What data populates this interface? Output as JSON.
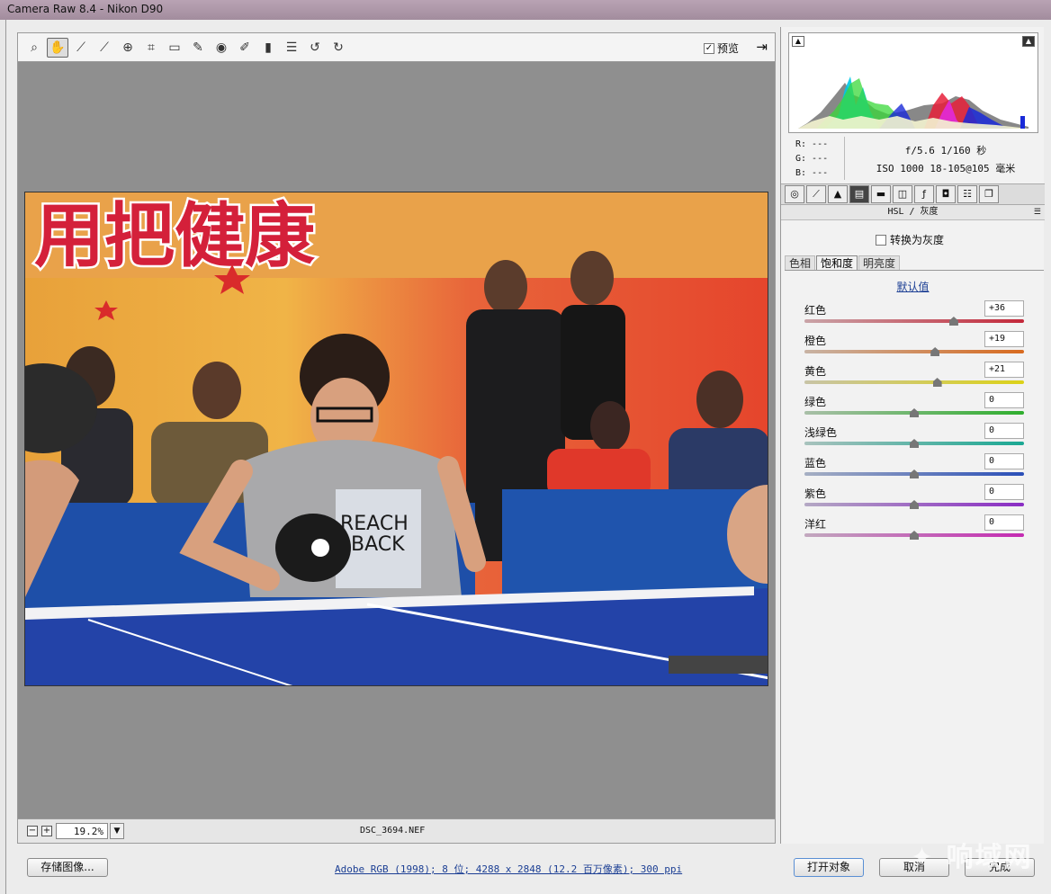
{
  "window": {
    "title": "Camera Raw 8.4 -  Nikon D90"
  },
  "toolbar": {
    "tools": [
      {
        "name": "zoom-tool-icon",
        "glyph": "⌕"
      },
      {
        "name": "hand-tool-icon",
        "glyph": "✋",
        "active": true
      },
      {
        "name": "white-balance-tool-icon",
        "glyph": "⁄"
      },
      {
        "name": "color-sampler-tool-icon",
        "glyph": "⁄"
      },
      {
        "name": "targeted-adjustment-tool-icon",
        "glyph": "⊕"
      },
      {
        "name": "crop-tool-icon",
        "glyph": "⌗"
      },
      {
        "name": "straighten-tool-icon",
        "glyph": "▭"
      },
      {
        "name": "spot-removal-tool-icon",
        "glyph": "⁄"
      },
      {
        "name": "red-eye-tool-icon",
        "glyph": "◉"
      },
      {
        "name": "adjustment-brush-icon",
        "glyph": "⁄"
      },
      {
        "name": "graduated-filter-icon",
        "glyph": "▮"
      },
      {
        "name": "preferences-icon",
        "glyph": "☰"
      },
      {
        "name": "rotate-left-icon",
        "glyph": "↺"
      },
      {
        "name": "rotate-right-icon",
        "glyph": "↻"
      }
    ],
    "preview_label": "预览",
    "preview_checked": "✓"
  },
  "status": {
    "zoom": "19.2%",
    "filename": "DSC_3694.NEF"
  },
  "info": {
    "r": "R:  ---",
    "g": "G:  ---",
    "b": "B:  ---",
    "exposure": "f/5.6   1/160 秒",
    "iso_lens": "ISO 1000   18-105@105 毫米"
  },
  "panel": {
    "title": "HSL / 灰度",
    "convert_gray_label": "转换为灰度",
    "subtabs": [
      "色相",
      "饱和度",
      "明亮度"
    ],
    "active_subtab": 1,
    "default_link": "默认值",
    "sliders": [
      {
        "label": "红色",
        "value": "+36",
        "level": 36,
        "track": "linear-gradient(90deg,#c9a4a8,#c4283a)"
      },
      {
        "label": "橙色",
        "value": "+19",
        "level": 19,
        "track": "linear-gradient(90deg,#c8b3a4,#d86a1e)"
      },
      {
        "label": "黄色",
        "value": "+21",
        "level": 21,
        "track": "linear-gradient(90deg,#c8c4a6,#dcd218)"
      },
      {
        "label": "绿色",
        "value": "0",
        "level": 0,
        "track": "linear-gradient(90deg,#a9bfa8,#2fae2e)"
      },
      {
        "label": "浅绿色",
        "value": "0",
        "level": 0,
        "track": "linear-gradient(90deg,#a8c2bd,#1aa893)"
      },
      {
        "label": "蓝色",
        "value": "0",
        "level": 0,
        "track": "linear-gradient(90deg,#a6afc3,#2a4fb8)"
      },
      {
        "label": "紫色",
        "value": "0",
        "level": 0,
        "track": "linear-gradient(90deg,#b4a8c4,#8a2cc4)"
      },
      {
        "label": "洋红",
        "value": "0",
        "level": 0,
        "track": "linear-gradient(90deg,#c2a8be,#c42ab2)"
      }
    ]
  },
  "footer": {
    "save_label": "存储图像...",
    "workflow": "Adobe RGB (1998); 8 位; 4288 x 2848 (12.2 百万像素); 300 ppi",
    "open_label": "打开对象",
    "cancel_label": "取消",
    "done_label": "完成"
  },
  "photo": {
    "banner_text": "用把健康",
    "shirt_text_1": "REACH",
    "shirt_text_2": "BACK"
  }
}
